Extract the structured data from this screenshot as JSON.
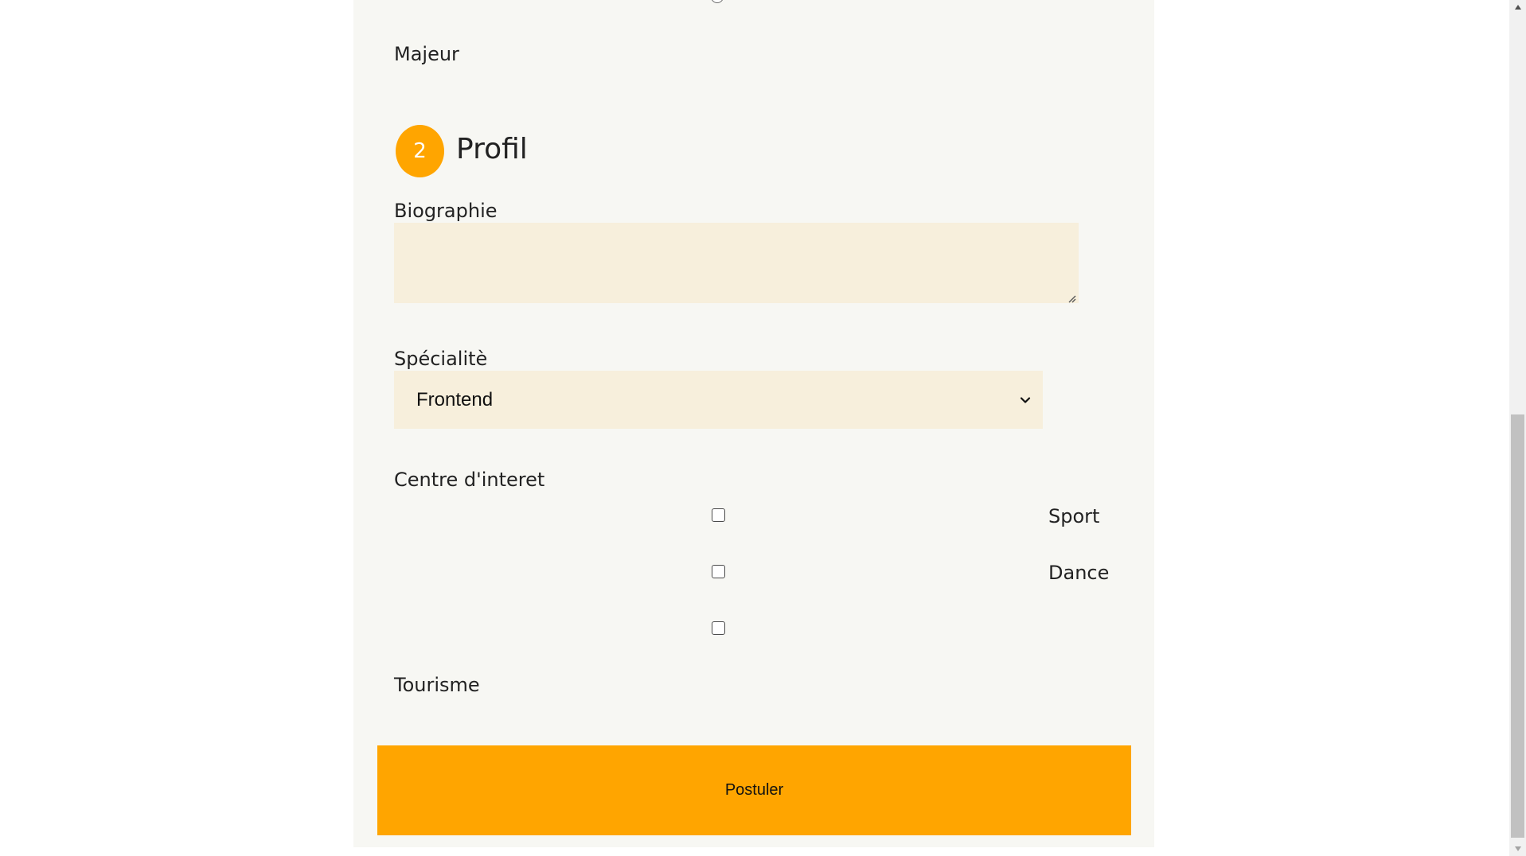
{
  "form": {
    "age_option_label": "Majeur",
    "section": {
      "step_number": "2",
      "title": "Profil"
    },
    "biography": {
      "label": "Biographie",
      "value": ""
    },
    "speciality": {
      "label": "Spécialitè",
      "selected": "Frontend"
    },
    "interests": {
      "label": "Centre d'interet",
      "options": [
        {
          "label": "Sport",
          "checked": false
        },
        {
          "label": "Dance",
          "checked": false
        },
        {
          "label": "Tourisme",
          "checked": false
        }
      ]
    },
    "submit_label": "Postuler"
  },
  "colors": {
    "accent": "#ffa500",
    "field_background": "#f7efdc",
    "card_background": "#f7f7f3"
  },
  "icons": {
    "select_chevron": "chevron-down-icon",
    "resize_grip": "resize-grip-icon",
    "scroll_up": "arrow-up-icon",
    "scroll_down": "arrow-down-icon"
  }
}
